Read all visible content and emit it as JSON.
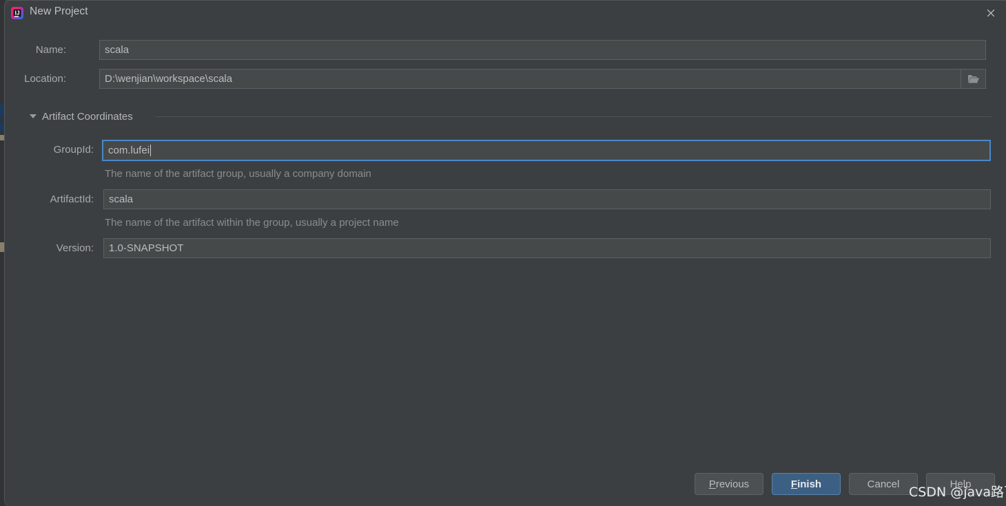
{
  "window": {
    "title": "New Project",
    "icon": "intellij-idea-logo-icon",
    "close_icon": "close-icon"
  },
  "form": {
    "name": {
      "label": "Name:",
      "value": "scala"
    },
    "location": {
      "label": "Location:",
      "value": "D:\\wenjian\\workspace\\scala",
      "browse_icon": "folder-icon"
    }
  },
  "artifact_section": {
    "title": "Artifact Coordinates",
    "expanded": true,
    "collapse_icon": "triangle-down-icon",
    "group_id": {
      "label": "GroupId:",
      "value": "com.lufei",
      "hint": "The name of the artifact group, usually a company domain",
      "focused": true
    },
    "artifact_id": {
      "label": "ArtifactId:",
      "value": "scala",
      "hint": "The name of the artifact within the group, usually a project name"
    },
    "version": {
      "label": "Version:",
      "value": "1.0-SNAPSHOT"
    }
  },
  "buttons": {
    "previous": {
      "label": "Previous",
      "mnemonic": "P",
      "rest": "revious"
    },
    "finish": {
      "label": "Finish",
      "mnemonic": "F",
      "rest": "inish",
      "primary": true
    },
    "cancel": {
      "label": "Cancel"
    },
    "help": {
      "label": "Help"
    }
  },
  "watermark": {
    "text": "CSDN @java路飞"
  },
  "colors": {
    "dialog_background": "#3c3f41",
    "field_background": "#45494a",
    "field_border": "#5e6060",
    "focus_border": "#4a88c7",
    "primary_button": "#3c6084",
    "primary_button_border": "#5a82ab",
    "label_text": "#a9abad",
    "hint_text": "#8a8d8f",
    "value_text": "#bbbdbf"
  }
}
